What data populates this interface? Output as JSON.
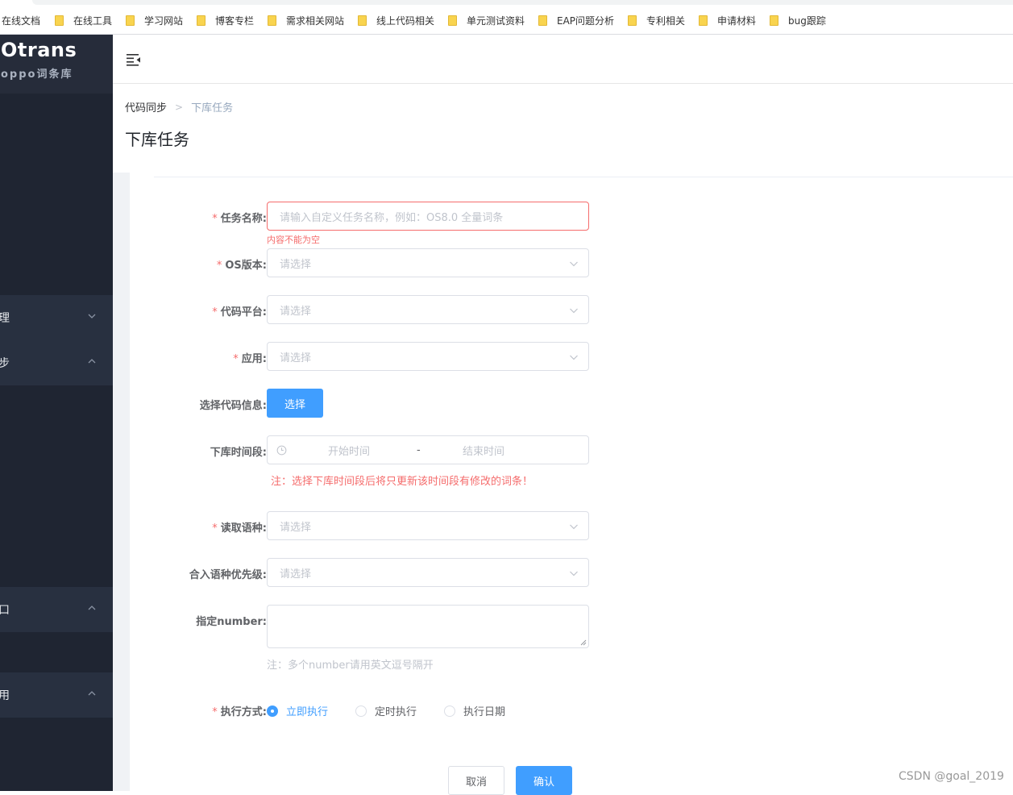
{
  "bookmarks": [
    {
      "label": "在线文档",
      "folder": false
    },
    {
      "label": "在线工具",
      "folder": true
    },
    {
      "label": "学习网站",
      "folder": true
    },
    {
      "label": "博客专栏",
      "folder": true
    },
    {
      "label": "需求相关网站",
      "folder": true
    },
    {
      "label": "线上代码相关",
      "folder": true
    },
    {
      "label": "单元测试资料",
      "folder": true
    },
    {
      "label": "EAP问题分析",
      "folder": true
    },
    {
      "label": "专利相关",
      "folder": true
    },
    {
      "label": "申请材料",
      "folder": true
    },
    {
      "label": "bug跟踪",
      "folder": true
    }
  ],
  "sidebar": {
    "title": "Otrans",
    "subtitle": "oppo词条库",
    "menus": [
      {
        "label": "理",
        "chevron": "down"
      },
      {
        "label": "步",
        "chevron": "up"
      },
      {
        "label": "口",
        "chevron": "up"
      },
      {
        "label": "用",
        "chevron": "up"
      }
    ]
  },
  "breadcrumb": {
    "parent": "代码同步",
    "separator": ">",
    "current": "下库任务"
  },
  "page_title": "下库任务",
  "form": {
    "task_name": {
      "label": "任务名称:",
      "placeholder": "请输入自定义任务名称，例如：OS8.0 全量词条",
      "error": "内容不能为空"
    },
    "os_version": {
      "label": "OS版本:",
      "placeholder": "请选择"
    },
    "code_platform": {
      "label": "代码平台:",
      "placeholder": "请选择"
    },
    "app": {
      "label": "应用:",
      "placeholder": "请选择"
    },
    "code_info": {
      "label": "选择代码信息:",
      "button": "选择"
    },
    "time_range": {
      "label": "下库时间段:",
      "start": "开始时间",
      "separator": "-",
      "end": "结束时间",
      "note": "注：选择下库时间段后将只更新该时间段有修改的词条！"
    },
    "read_lang": {
      "label": "读取语种:",
      "placeholder": "请选择"
    },
    "merge_priority": {
      "label": "合入语种优先级:",
      "placeholder": "请选择"
    },
    "number": {
      "label": "指定number:",
      "note": "注：多个number请用英文逗号隔开"
    },
    "exec_mode": {
      "label": "执行方式:",
      "options": [
        "立即执行",
        "定时执行",
        "执行日期"
      ],
      "selected": 0
    },
    "cancel": "取消",
    "confirm": "确认"
  },
  "watermark": "CSDN @goal_2019",
  "colors": {
    "primary": "#409eff",
    "error": "#f56c6c",
    "sidebar": "#1f2532"
  }
}
